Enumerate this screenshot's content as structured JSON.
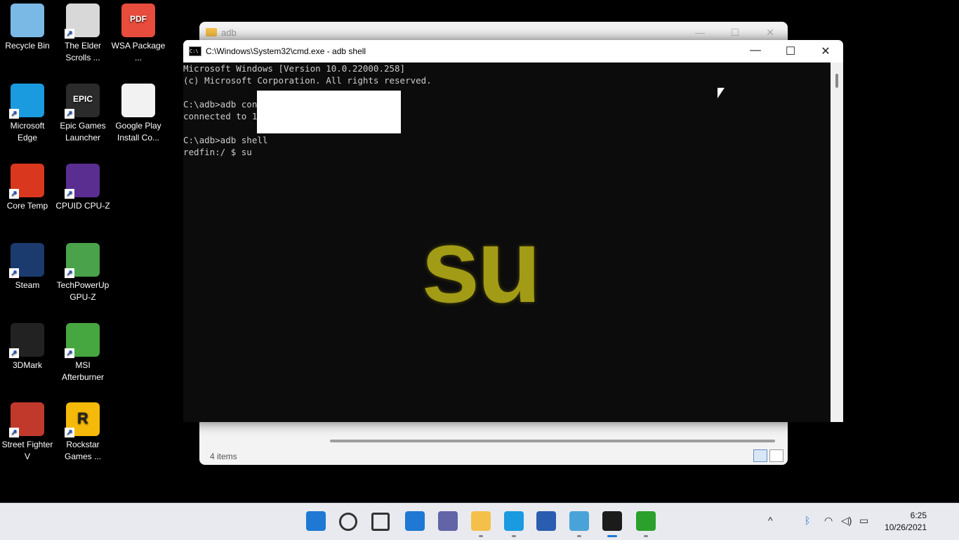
{
  "desktop": {
    "icons": [
      {
        "label": "Recycle Bin",
        "color": "#7ab8e6"
      },
      {
        "label": "The Elder Scrolls ...",
        "color": "#d8d8d8"
      },
      {
        "label": "WSA Package ...",
        "color": "#e74c3c"
      },
      {
        "label": "Microsoft Edge",
        "color": "#1a9be0"
      },
      {
        "label": "Epic Games Launcher",
        "color": "#2b2b2b"
      },
      {
        "label": "Google Play Install Co...",
        "color": "#f2f2f2"
      },
      {
        "label": "Core Temp",
        "color": "#d9381e"
      },
      {
        "label": "CPUID CPU-Z",
        "color": "#5a2d91"
      },
      {
        "label": "Steam",
        "color": "#1b3b6f"
      },
      {
        "label": "TechPowerUp GPU-Z",
        "color": "#4aa24a"
      },
      {
        "label": "3DMark",
        "color": "#222222"
      },
      {
        "label": "MSI Afterburner",
        "color": "#46a63f"
      },
      {
        "label": "Street Fighter V",
        "color": "#c0392b"
      },
      {
        "label": "Rockstar Games ...",
        "color": "#f5b90a"
      }
    ],
    "icon_glyphs": {
      "wsa": "PDF",
      "epic": "EPIC",
      "rockstar": "R"
    }
  },
  "explorer": {
    "title": "adb",
    "status": "4 items"
  },
  "cmd": {
    "title": "C:\\Windows\\System32\\cmd.exe - adb  shell",
    "lines": [
      "Microsoft Windows [Version 10.0.22000.258]",
      "(c) Microsoft Corporation. All rights reserved.",
      "",
      "C:\\adb>adb con",
      "connected to 1",
      "",
      "C:\\adb>adb shell",
      "redfin:/ $ su"
    ],
    "overlay_text": "su"
  },
  "window_controls": {
    "minimize": "—",
    "maximize": "☐",
    "close": "✕"
  },
  "taskbar": {
    "apps": [
      {
        "name": "start",
        "color": "#1e78d4"
      },
      {
        "name": "search",
        "color": "#333333"
      },
      {
        "name": "task-view",
        "color": "#333333"
      },
      {
        "name": "widgets",
        "color": "#1e78d4"
      },
      {
        "name": "chat",
        "color": "#6264a7"
      },
      {
        "name": "file-explorer",
        "color": "#f5c04a"
      },
      {
        "name": "edge",
        "color": "#1a9be0"
      },
      {
        "name": "store",
        "color": "#2a5db0"
      },
      {
        "name": "notepad",
        "color": "#4aa3d8"
      },
      {
        "name": "terminal",
        "color": "#1b1b1b"
      },
      {
        "name": "android",
        "color": "#2ca02c"
      }
    ],
    "clock_time": "6:25",
    "clock_date": "10/26/2021"
  }
}
